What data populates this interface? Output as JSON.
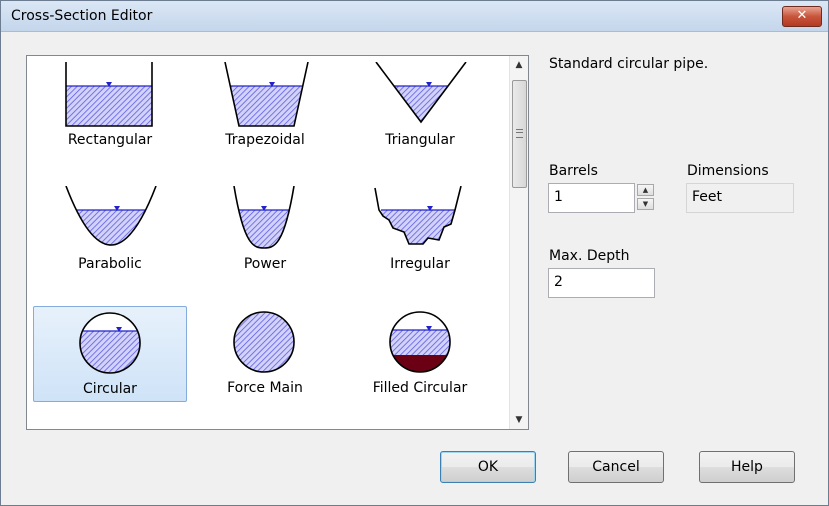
{
  "window": {
    "title": "Cross-Section Editor",
    "close_label": "✕"
  },
  "shapes": [
    {
      "label": "Rectangular",
      "icon": "rectangular-channel-icon"
    },
    {
      "label": "Trapezoidal",
      "icon": "trapezoidal-channel-icon"
    },
    {
      "label": "Triangular",
      "icon": "triangular-channel-icon"
    },
    {
      "label": "Parabolic",
      "icon": "parabolic-channel-icon"
    },
    {
      "label": "Power",
      "icon": "power-channel-icon"
    },
    {
      "label": "Irregular",
      "icon": "irregular-channel-icon"
    },
    {
      "label": "Circular",
      "icon": "circular-pipe-icon",
      "selected": true
    },
    {
      "label": "Force Main",
      "icon": "force-main-pipe-icon"
    },
    {
      "label": "Filled Circular",
      "icon": "filled-circular-pipe-icon"
    }
  ],
  "description": "Standard circular pipe.",
  "barrels": {
    "label": "Barrels",
    "value": "1"
  },
  "dimensions": {
    "label": "Dimensions",
    "value": "Feet"
  },
  "max_depth": {
    "label": "Max. Depth",
    "value": "2"
  },
  "buttons": {
    "ok": "OK",
    "cancel": "Cancel",
    "help": "Help"
  },
  "colors": {
    "water_hatch": "#5c5ce0",
    "fill_sediment": "#6b0014",
    "selection": "#cfe3f8"
  }
}
